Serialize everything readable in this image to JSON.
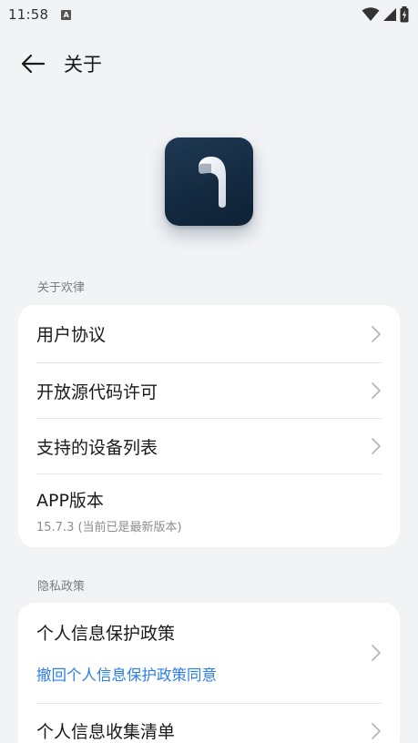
{
  "status_bar": {
    "time": "11:58",
    "notification_icon": "a-icon",
    "icons": [
      "wifi-icon",
      "signal-icon",
      "battery-charging-icon"
    ]
  },
  "header": {
    "back_icon": "arrow-left-icon",
    "title": "关于"
  },
  "logo": {
    "name": "app-logo"
  },
  "section_about": {
    "label": "关于欢律",
    "items": [
      {
        "label": "用户协议"
      },
      {
        "label": "开放源代码许可"
      },
      {
        "label": "支持的设备列表"
      }
    ],
    "version": {
      "label": "APP版本",
      "value": "15.7.3 (当前已是最新版本)"
    }
  },
  "section_privacy": {
    "label": "隐私政策",
    "items": [
      {
        "label": "个人信息保护政策",
        "link": "撤回个人信息保护政策同意"
      },
      {
        "label": "个人信息收集清单"
      }
    ]
  },
  "colors": {
    "background": "#f1f3f5",
    "card": "#ffffff",
    "accent_link": "#2b7de9",
    "logo_bg": "#142a40"
  }
}
